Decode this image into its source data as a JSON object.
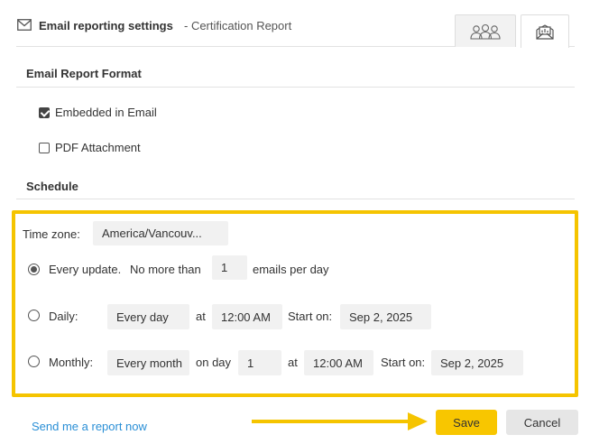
{
  "header": {
    "title": "Email reporting settings",
    "subtitle": "- Certification Report",
    "icons": [
      "envelope-icon",
      "users-icon",
      "report-envelope-icon"
    ]
  },
  "format": {
    "title": "Email Report Format",
    "embedded": {
      "label": "Embedded in Email",
      "checked": true
    },
    "pdf": {
      "label": "PDF Attachment",
      "checked": false
    }
  },
  "schedule": {
    "title": "Schedule",
    "timezone_label": "Time zone:",
    "timezone_value": "America/Vancouv...",
    "every_update": {
      "label": "Every update.",
      "no_more_than": "No more than",
      "count": "1",
      "suffix": "emails per day",
      "selected": true
    },
    "daily": {
      "label": "Daily:",
      "frequency": "Every day",
      "at_label": "at",
      "time": "12:00 AM",
      "start_label": "Start on:",
      "start_date": "Sep 2, 2025",
      "selected": false
    },
    "monthly": {
      "label": "Monthly:",
      "frequency": "Every month",
      "on_day_label": "on day",
      "day": "1",
      "at_label": "at",
      "time": "12:00 AM",
      "start_label": "Start on:",
      "start_date": "Sep 2, 2025",
      "selected": false
    }
  },
  "footer": {
    "send_now_link": "Send me a report now",
    "save_label": "Save",
    "cancel_label": "Cancel"
  },
  "colors": {
    "highlight": "#f5c400",
    "save_button": "#f8c600",
    "link": "#2a8fd6",
    "field_bg": "#f1f1f1"
  }
}
